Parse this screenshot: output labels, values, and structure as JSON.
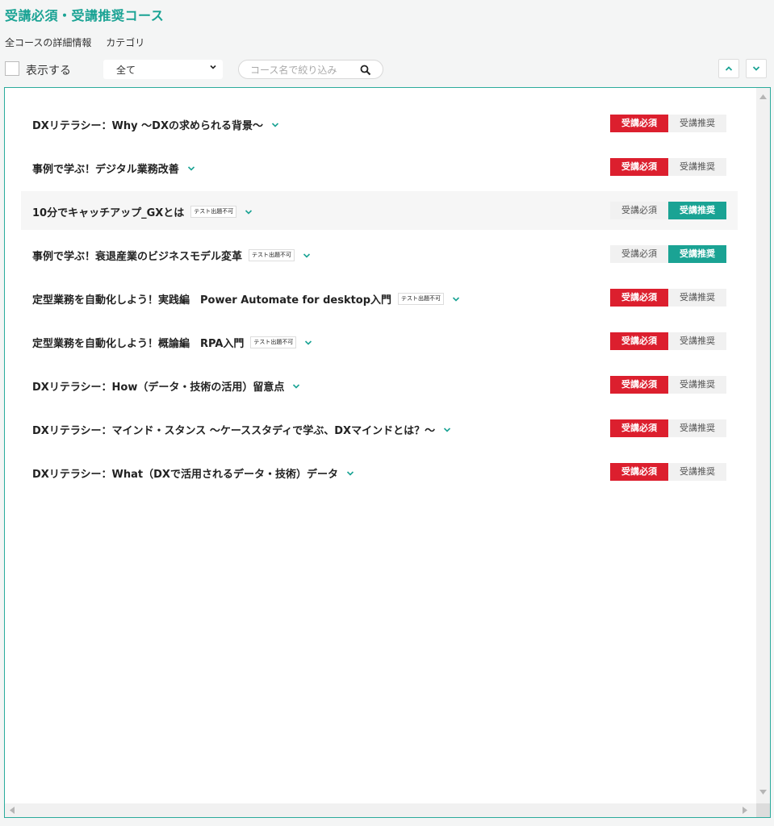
{
  "title": "受講必須・受講推奨コース",
  "links": [
    "全コースの詳細情報",
    "カテゴリ"
  ],
  "filter": {
    "show_label": "表示する",
    "select_value": "全て",
    "search_placeholder": "コース名で絞り込み"
  },
  "badge_labels": {
    "required": "受講必須",
    "recommended": "受講推奨"
  },
  "colors": {
    "accent": "#1aa394",
    "required": "#dc1f2e"
  },
  "courses": [
    {
      "name": "DXリテラシー：Why ～DXの求められる背景～",
      "tag": "",
      "status": "required"
    },
    {
      "name": "事例で学ぶ！デジタル業務改善",
      "tag": "",
      "status": "required"
    },
    {
      "name": "10分でキャッチアップ_GXとは",
      "tag": "テスト出題不可",
      "status": "recommended"
    },
    {
      "name": "事例で学ぶ！衰退産業のビジネスモデル変革",
      "tag": "テスト出題不可",
      "status": "recommended"
    },
    {
      "name": "定型業務を自動化しよう！実践編　Power Automate for desktop入門",
      "tag": "テスト出題不可",
      "status": "required"
    },
    {
      "name": "定型業務を自動化しよう！概論編　RPA入門",
      "tag": "テスト出題不可",
      "status": "required"
    },
    {
      "name": "DXリテラシー：How（データ・技術の活用）留意点",
      "tag": "",
      "status": "required"
    },
    {
      "name": "DXリテラシー：マインド・スタンス ～ケーススタディで学ぶ、DXマインドとは？～",
      "tag": "",
      "status": "required"
    },
    {
      "name": "DXリテラシー：What（DXで活用されるデータ・技術）データ",
      "tag": "",
      "status": "required"
    }
  ]
}
